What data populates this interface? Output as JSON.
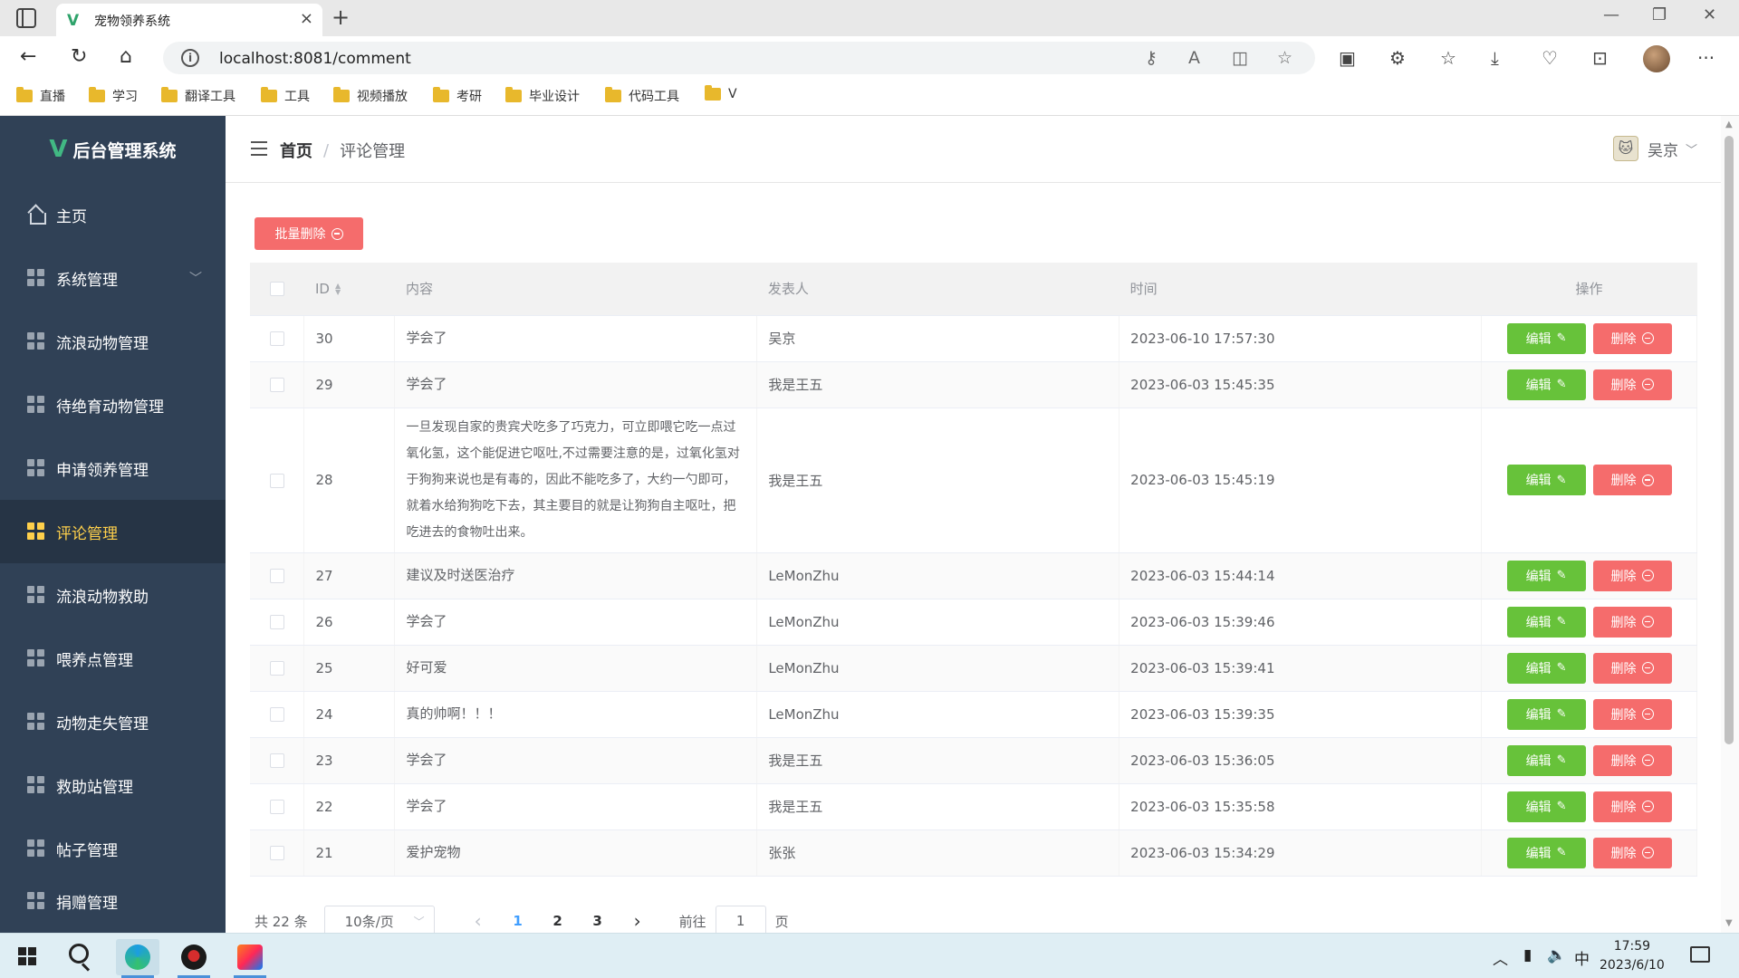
{
  "browser": {
    "tab_title": "宠物领养系统",
    "url": "localhost:8081/comment",
    "bookmarks": [
      "直播",
      "学习",
      "翻译工具",
      "工具",
      "视频播放",
      "考研",
      "毕业设计",
      "代码工具",
      "V"
    ]
  },
  "app": {
    "logo_title": "后台管理系统",
    "sidebar": {
      "items": [
        {
          "label": "主页",
          "icon": "home-icon"
        },
        {
          "label": "系统管理",
          "icon": "grid-icon",
          "expandable": true
        },
        {
          "label": "流浪动物管理",
          "icon": "grid-icon"
        },
        {
          "label": "待绝育动物管理",
          "icon": "grid-icon"
        },
        {
          "label": "申请领养管理",
          "icon": "grid-icon"
        },
        {
          "label": "评论管理",
          "icon": "grid-icon",
          "active": true
        },
        {
          "label": "流浪动物救助",
          "icon": "grid-icon"
        },
        {
          "label": "喂养点管理",
          "icon": "grid-icon"
        },
        {
          "label": "动物走失管理",
          "icon": "grid-icon"
        },
        {
          "label": "救助站管理",
          "icon": "grid-icon"
        },
        {
          "label": "帖子管理",
          "icon": "grid-icon"
        },
        {
          "label": "捐赠管理",
          "icon": "grid-icon"
        }
      ]
    },
    "breadcrumb": {
      "home": "首页",
      "separator": "/",
      "current": "评论管理"
    },
    "user": {
      "name": "吴京"
    },
    "toolbar": {
      "batch_delete_label": "批量删除"
    },
    "table": {
      "headers": {
        "id": "ID",
        "content": "内容",
        "author": "发表人",
        "time": "时间",
        "actions": "操作"
      },
      "edit_label": "编辑",
      "delete_label": "删除",
      "rows": [
        {
          "id": "30",
          "content": "学会了",
          "author": "吴京",
          "time": "2023-06-10 17:57:30"
        },
        {
          "id": "29",
          "content": "学会了",
          "author": "我是王五",
          "time": "2023-06-03 15:45:35"
        },
        {
          "id": "28",
          "content": "一旦发现自家的贵宾犬吃多了巧克力，可立即喂它吃一点过氧化氢，这个能促进它呕吐,不过需要注意的是，过氧化氢对于狗狗来说也是有毒的，因此不能吃多了，大约一勺即可，就着水给狗狗吃下去，其主要目的就是让狗狗自主呕吐，把吃进去的食物吐出来。",
          "author": "我是王五",
          "time": "2023-06-03 15:45:19",
          "tall": true
        },
        {
          "id": "27",
          "content": "建议及时送医治疗",
          "author": "LeMonZhu",
          "time": "2023-06-03 15:44:14"
        },
        {
          "id": "26",
          "content": "学会了",
          "author": "LeMonZhu",
          "time": "2023-06-03 15:39:46"
        },
        {
          "id": "25",
          "content": "好可爱",
          "author": "LeMonZhu",
          "time": "2023-06-03 15:39:41"
        },
        {
          "id": "24",
          "content": "真的帅啊！！！",
          "author": "LeMonZhu",
          "time": "2023-06-03 15:39:35"
        },
        {
          "id": "23",
          "content": "学会了",
          "author": "我是王五",
          "time": "2023-06-03 15:36:05"
        },
        {
          "id": "22",
          "content": "学会了",
          "author": "我是王五",
          "time": "2023-06-03 15:35:58"
        },
        {
          "id": "21",
          "content": "爱护宠物",
          "author": "张张",
          "time": "2023-06-03 15:34:29"
        }
      ]
    },
    "pagination": {
      "total_text": "共 22 条",
      "page_size": "10条/页",
      "pages": [
        "1",
        "2",
        "3"
      ],
      "current_page": "1",
      "goto_label": "前往",
      "goto_value": "1",
      "goto_suffix": "页"
    }
  },
  "taskbar": {
    "time": "17:59",
    "date": "2023/6/10",
    "ime": "中"
  },
  "colors": {
    "sidebar_bg": "#304156",
    "sidebar_active_text": "#ffd04b",
    "danger": "#f56c6c",
    "success": "#67c23a",
    "primary": "#409eff"
  }
}
